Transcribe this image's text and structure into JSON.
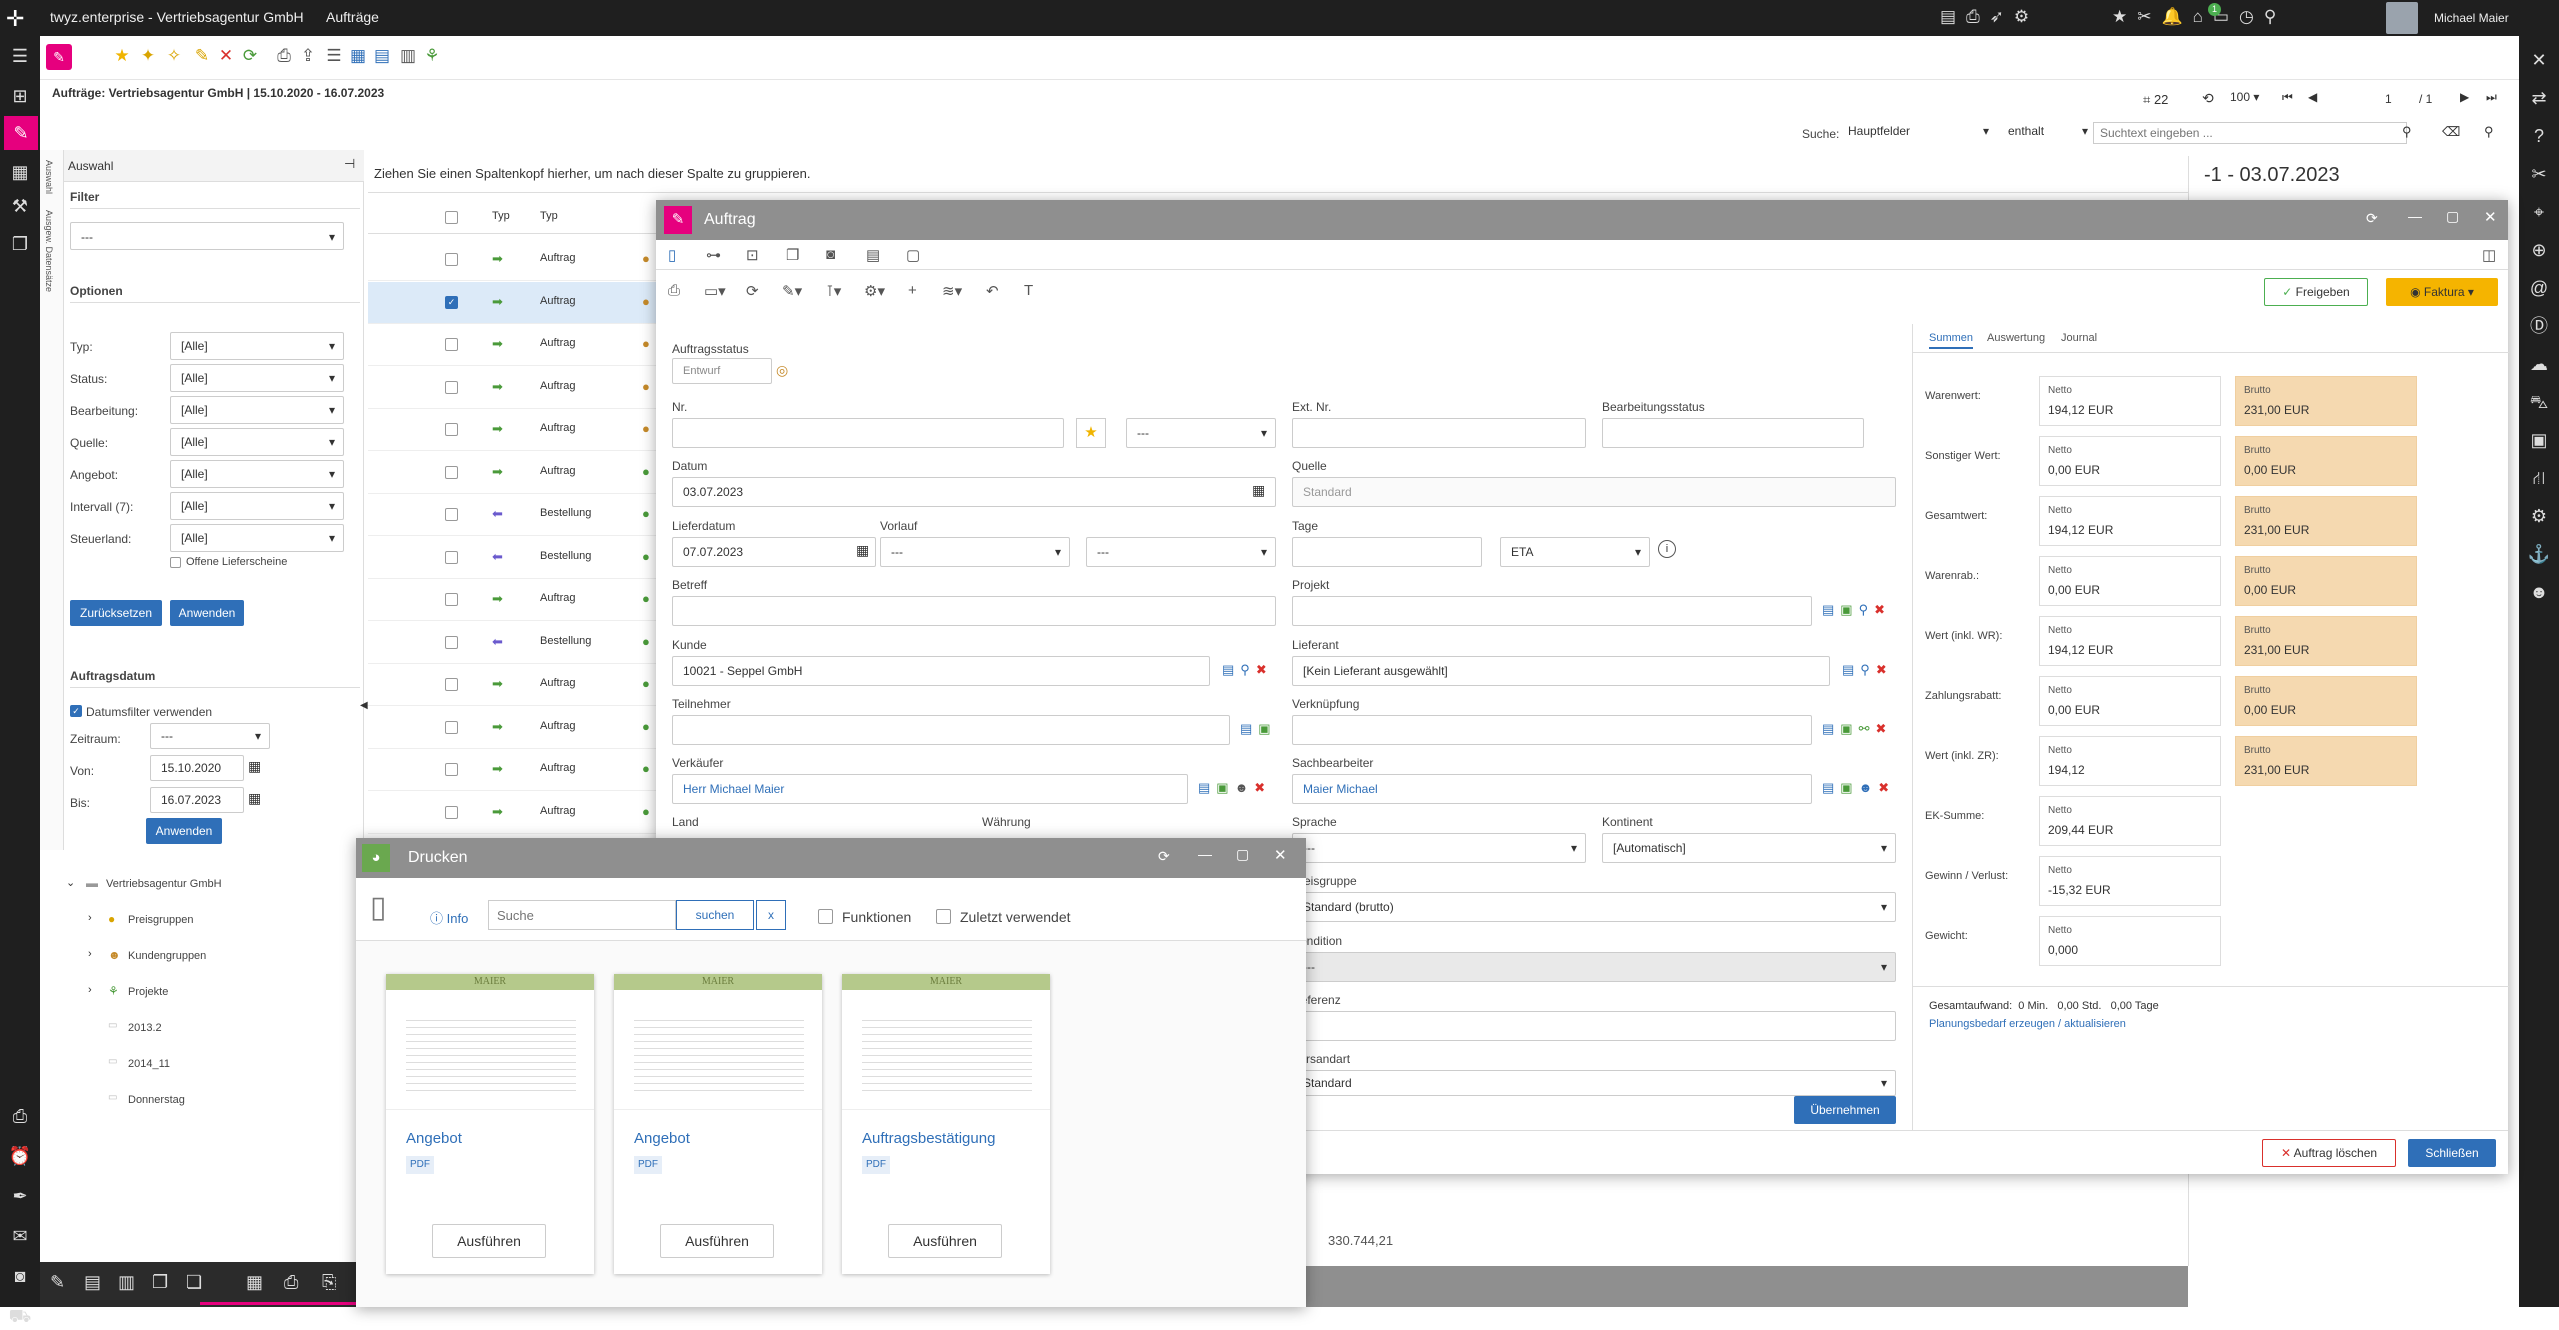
{
  "topbar": {
    "logo": "twyz.enterprise - Vertriebsagentur GmbH",
    "module": "Aufträge",
    "user": "Michael Maier",
    "badge": "1"
  },
  "header": {
    "title": "Aufträge: Vertriebsagentur GmbH | 15.10.2020 - 16.07.2023",
    "count": "22",
    "pagesize": "100",
    "page": "1",
    "pages": "/ 1"
  },
  "search": {
    "label": "Suche:",
    "field": "Hauptfelder",
    "op": "enthalt",
    "placeholder": "Suchtext eingeben ..."
  },
  "sidepanel": {
    "title": "Auswahl",
    "vtab1": "Auswahl",
    "vtab2": "Ausgew. Datensätze",
    "filter_title": "Filter",
    "filter_value": "---",
    "optionen": "Optionen",
    "options": [
      {
        "label": "Typ:",
        "value": "[Alle]"
      },
      {
        "label": "Status:",
        "value": "[Alle]"
      },
      {
        "label": "Bearbeitung:",
        "value": "[Alle]"
      },
      {
        "label": "Quelle:",
        "value": "[Alle]"
      },
      {
        "label": "Angebot:",
        "value": "[Alle]"
      },
      {
        "label": "Intervall (7):",
        "value": "[Alle]"
      },
      {
        "label": "Steuerland:",
        "value": "[Alle]"
      }
    ],
    "offene": "Offene Lieferscheine",
    "reset": "Zurücksetzen",
    "apply": "Anwenden",
    "auftragsdatum": "Auftragsdatum",
    "datefilter": "Datumsfilter verwenden",
    "zeitraum_label": "Zeitraum:",
    "zeitraum": "---",
    "von_label": "Von:",
    "von": "15.10.2020",
    "bis_label": "Bis:",
    "bis": "16.07.2023",
    "apply2": "Anwenden",
    "tree": [
      {
        "label": "Vertriebsagentur GmbH"
      },
      {
        "label": "Preisgruppen"
      },
      {
        "label": "Kundengruppen"
      },
      {
        "label": "Projekte"
      },
      {
        "label": "2013.2"
      },
      {
        "label": "2014_11"
      },
      {
        "label": "Donnerstag"
      }
    ]
  },
  "grid": {
    "group_hint": "Ziehen Sie einen Spaltenkopf hierher, um nach dieser Spalte zu gruppieren.",
    "col_typ": "Typ",
    "col_typ2": "Typ",
    "rows": [
      {
        "type": "Auftrag",
        "checked": false
      },
      {
        "type": "Auftrag",
        "checked": true
      },
      {
        "type": "Auftrag",
        "checked": false
      },
      {
        "type": "Auftrag",
        "checked": false
      },
      {
        "type": "Auftrag",
        "checked": false
      },
      {
        "type": "Auftrag",
        "checked": false
      },
      {
        "type": "Bestellung",
        "checked": false
      },
      {
        "type": "Bestellung",
        "checked": false
      },
      {
        "type": "Auftrag",
        "checked": false
      },
      {
        "type": "Bestellung",
        "checked": false
      },
      {
        "type": "Auftrag",
        "checked": false
      },
      {
        "type": "Auftrag",
        "checked": false
      },
      {
        "type": "Auftrag",
        "checked": false
      },
      {
        "type": "Auftrag",
        "checked": false
      }
    ],
    "total": "330.744,21",
    "right_date": "-1 - 03.07.2023"
  },
  "auftrag": {
    "title": "Auftrag",
    "freigeben": "Freigeben",
    "faktura": "Faktura",
    "status_label": "Auftragsstatus",
    "status": "Entwurf",
    "nr_label": "Nr.",
    "nr_value": "",
    "nr_select": "---",
    "extnr_label": "Ext. Nr.",
    "bstatus_label": "Bearbeitungsstatus",
    "datum_label": "Datum",
    "datum": "03.07.2023",
    "quelle_label": "Quelle",
    "quelle": "Standard",
    "lieferdatum_label": "Lieferdatum",
    "lieferdatum": "07.07.2023",
    "vorlauf_label": "Vorlauf",
    "vorlauf1": "---",
    "vorlauf2": "---",
    "tage_label": "Tage",
    "eta": "ETA",
    "betreff_label": "Betreff",
    "projekt_label": "Projekt",
    "kunde_label": "Kunde",
    "kunde": "10021 - Seppel GmbH",
    "lieferant_label": "Lieferant",
    "lieferant": "[Kein Lieferant ausgewählt]",
    "teilnehmer_label": "Teilnehmer",
    "verknuepfung_label": "Verknüpfung",
    "verkaeufer_label": "Verkäufer",
    "verkaeufer": "Herr Michael Maier",
    "sachbearbeiter_label": "Sachbearbeiter",
    "sachbearbeiter": "Maier Michael",
    "land_label": "Land",
    "waehrung_label": "Währung",
    "sprache_label": "Sprache",
    "sprache": "---",
    "kontinent_label": "Kontinent",
    "kontinent": "[Automatisch]",
    "preisgruppe_label": "Preisgruppe",
    "preisgruppe": "Standard (brutto)",
    "kondition_label": "Kondition",
    "kondition": "---",
    "referenz_label": "Referenz",
    "versandart_label": "Versandart",
    "versandart": "Standard",
    "uebernehmen": "Übernehmen",
    "loeschen": "Auftrag löschen",
    "schliessen": "Schließen",
    "tabs": [
      "Summen",
      "Auswertung",
      "Journal"
    ],
    "sums": [
      {
        "label": "Warenwert:",
        "netto": "194,12 EUR",
        "brutto": "231,00 EUR"
      },
      {
        "label": "Sonstiger Wert:",
        "netto": "0,00 EUR",
        "brutto": "0,00 EUR"
      },
      {
        "label": "Gesamtwert:",
        "netto": "194,12 EUR",
        "brutto": "231,00 EUR"
      },
      {
        "label": "Warenrab.:",
        "netto": "0,00 EUR",
        "brutto": "0,00 EUR"
      },
      {
        "label": "Wert (inkl. WR):",
        "netto": "194,12 EUR",
        "brutto": "231,00 EUR"
      },
      {
        "label": "Zahlungsrabatt:",
        "netto": "0,00 EUR",
        "brutto": "0,00 EUR"
      },
      {
        "label": "Wert (inkl. ZR):",
        "netto": "194,12",
        "brutto": "231,00 EUR"
      },
      {
        "label": "EK-Summe:",
        "netto": "209,44 EUR",
        "brutto": null
      },
      {
        "label": "Gewinn / Verlust:",
        "netto": "-15,32 EUR",
        "brutto": null
      },
      {
        "label": "Gewicht:",
        "netto": "0,000",
        "brutto": null
      }
    ],
    "netto_k": "Netto",
    "brutto_k": "Brutto",
    "gesamtaufwand": "Gesamtaufwand:  0 Min.   0,00 Std.   0,00 Tage",
    "planung": "Planungsbedarf erzeugen / aktualisieren"
  },
  "drucken": {
    "title": "Drucken",
    "info": "Info",
    "search_placeholder": "Suche",
    "suchen": "suchen",
    "x": "x",
    "funktionen": "Funktionen",
    "zuletzt": "Zuletzt verwendet",
    "tiles": [
      {
        "name": "Angebot",
        "badge": "PDF",
        "run": "Ausführen",
        "head": "MAIER"
      },
      {
        "name": "Angebot",
        "badge": "PDF",
        "run": "Ausführen",
        "head": "MAIER"
      },
      {
        "name": "Auftragsbestätigung",
        "badge": "PDF",
        "run": "Ausführen",
        "head": "MAIER"
      }
    ]
  },
  "colors": {
    "accent": "#e6007e",
    "blue": "#2f6fb8",
    "dark": "#1f1f1f",
    "brutto": "#f5d9b0",
    "green": "#4caf50"
  }
}
